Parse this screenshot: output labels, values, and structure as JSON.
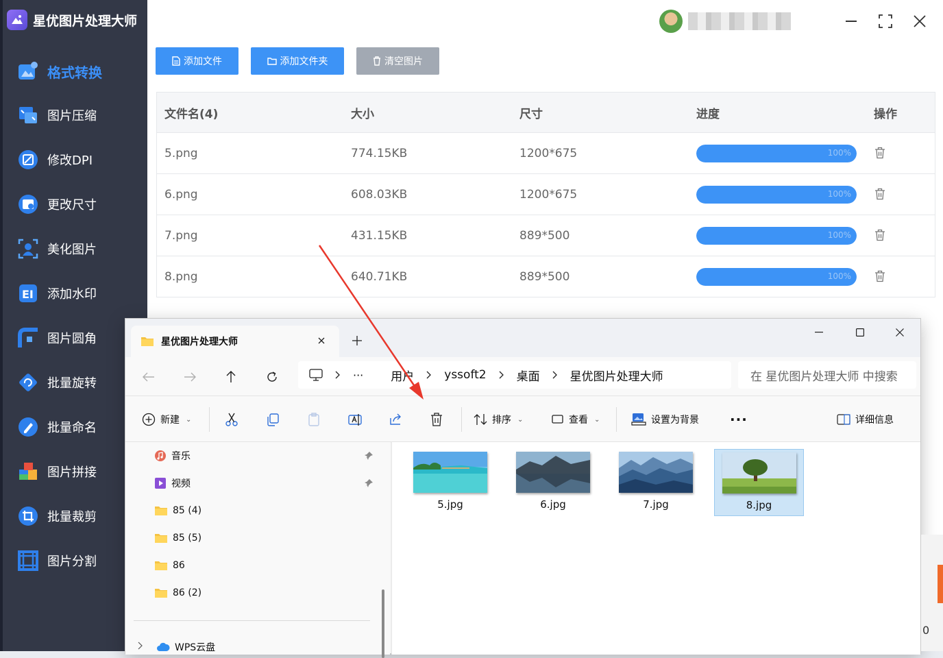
{
  "app": {
    "title": "星优图片处理大师",
    "username_obscured": "yssoft2_wb",
    "accent": "#3d93f6"
  },
  "sidebar": {
    "items": [
      {
        "label": "格式转换",
        "icon": "image-convert-icon",
        "active": true
      },
      {
        "label": "图片压缩",
        "icon": "image-compress-icon"
      },
      {
        "label": "修改DPI",
        "icon": "dpi-icon"
      },
      {
        "label": "更改尺寸",
        "icon": "resize-icon"
      },
      {
        "label": "美化图片",
        "icon": "beautify-icon"
      },
      {
        "label": "添加水印",
        "icon": "watermark-icon"
      },
      {
        "label": "图片圆角",
        "icon": "rounded-corner-icon"
      },
      {
        "label": "批量旋转",
        "icon": "rotate-icon"
      },
      {
        "label": "批量命名",
        "icon": "rename-icon"
      },
      {
        "label": "图片拼接",
        "icon": "stitch-icon"
      },
      {
        "label": "批量裁剪",
        "icon": "crop-icon"
      },
      {
        "label": "图片分割",
        "icon": "split-icon"
      }
    ]
  },
  "toolbar": {
    "add_file": "添加文件",
    "add_folder": "添加文件夹",
    "clear": "清空图片"
  },
  "table": {
    "headers": {
      "name": "文件名(4)",
      "size": "大小",
      "dim": "尺寸",
      "progress": "进度",
      "op": "操作"
    },
    "rows": [
      {
        "name": "5.png",
        "size": "774.15KB",
        "dim": "1200*675",
        "progress": 1.0,
        "progress_label": "100%"
      },
      {
        "name": "6.png",
        "size": "608.03KB",
        "dim": "1200*675",
        "progress": 1.0,
        "progress_label": "100%"
      },
      {
        "name": "7.png",
        "size": "431.15KB",
        "dim": "889*500",
        "progress": 1.0,
        "progress_label": "100%"
      },
      {
        "name": "8.png",
        "size": "640.71KB",
        "dim": "889*500",
        "progress": 1.0,
        "progress_label": "100%"
      }
    ]
  },
  "explorer": {
    "tab_title": "星优图片处理大师",
    "breadcrumb": [
      "用户",
      "yssoft2",
      "桌面",
      "星优图片处理大师"
    ],
    "search_placeholder": "在 星优图片处理大师 中搜索",
    "commands": {
      "new": "新建",
      "sort": "排序",
      "view": "查看",
      "set_bg": "设置为背景",
      "details": "详细信息"
    },
    "nav_items": [
      {
        "label": "音乐",
        "icon": "music-icon",
        "pinned": true
      },
      {
        "label": "视频",
        "icon": "video-icon",
        "pinned": true
      },
      {
        "label": "85 (4)",
        "icon": "folder-icon"
      },
      {
        "label": "85 (5)",
        "icon": "folder-icon"
      },
      {
        "label": "86",
        "icon": "folder-icon"
      },
      {
        "label": "86 (2)",
        "icon": "folder-icon"
      },
      {
        "label": "WPS云盘",
        "icon": "wps-cloud-icon"
      }
    ],
    "files": [
      {
        "name": "5.jpg",
        "selected": false
      },
      {
        "name": "6.jpg",
        "selected": false
      },
      {
        "name": "7.jpg",
        "selected": false
      },
      {
        "name": "8.jpg",
        "selected": true
      }
    ],
    "edge_peek_text": "0"
  }
}
